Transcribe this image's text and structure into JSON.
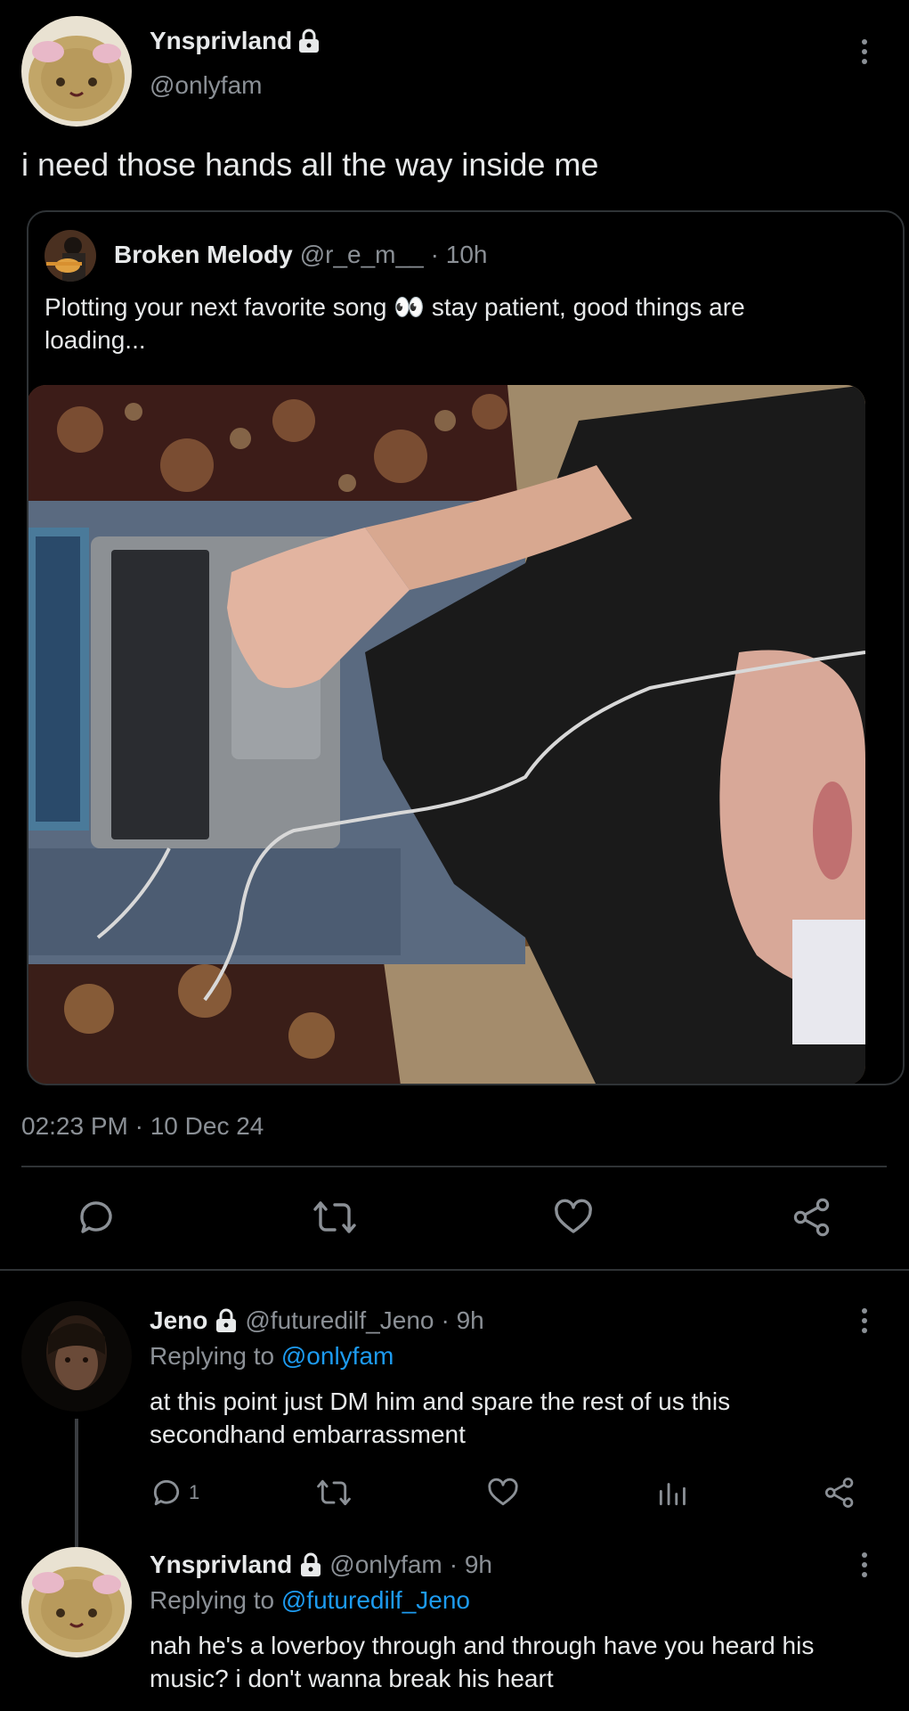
{
  "main_tweet": {
    "display_name": "Ynsprivland",
    "handle": "@onlyfam",
    "text": "i need those hands all the way inside me",
    "timestamp": "02:23 PM · 10 Dec 24"
  },
  "quoted_tweet": {
    "display_name": "Broken Melody",
    "handle": "@r_e_m__",
    "time": "· 10h",
    "text_line1": "Plotting your next favorite song 👀 stay patient, good things are",
    "text_line2": "loading..."
  },
  "actions": [
    "reply-icon",
    "retweet-icon",
    "like-icon",
    "share-icon"
  ],
  "replies": [
    {
      "display_name": "Jeno",
      "handle": "@futuredilf_Jeno",
      "time": "· 9h",
      "replying_prefix": "Replying to",
      "replying_to": "@onlyfam",
      "text_line1": "at this point just DM him and spare the rest of us this",
      "text_line2": "secondhand embarrassment",
      "reply_count": "1"
    },
    {
      "display_name": "Ynsprivland",
      "handle": "@onlyfam",
      "time": "· 9h",
      "replying_prefix": "Replying to",
      "replying_to": "@futuredilf_Jeno",
      "text_line1": "nah he's a loverboy through and through have you heard his",
      "text_line2": "music? i don't wanna break his heart"
    }
  ],
  "colors": {
    "background": "#000000",
    "text": "#e7e9ea",
    "muted": "#71767b",
    "link": "#1d9bf0",
    "divider": "#2f3336"
  }
}
